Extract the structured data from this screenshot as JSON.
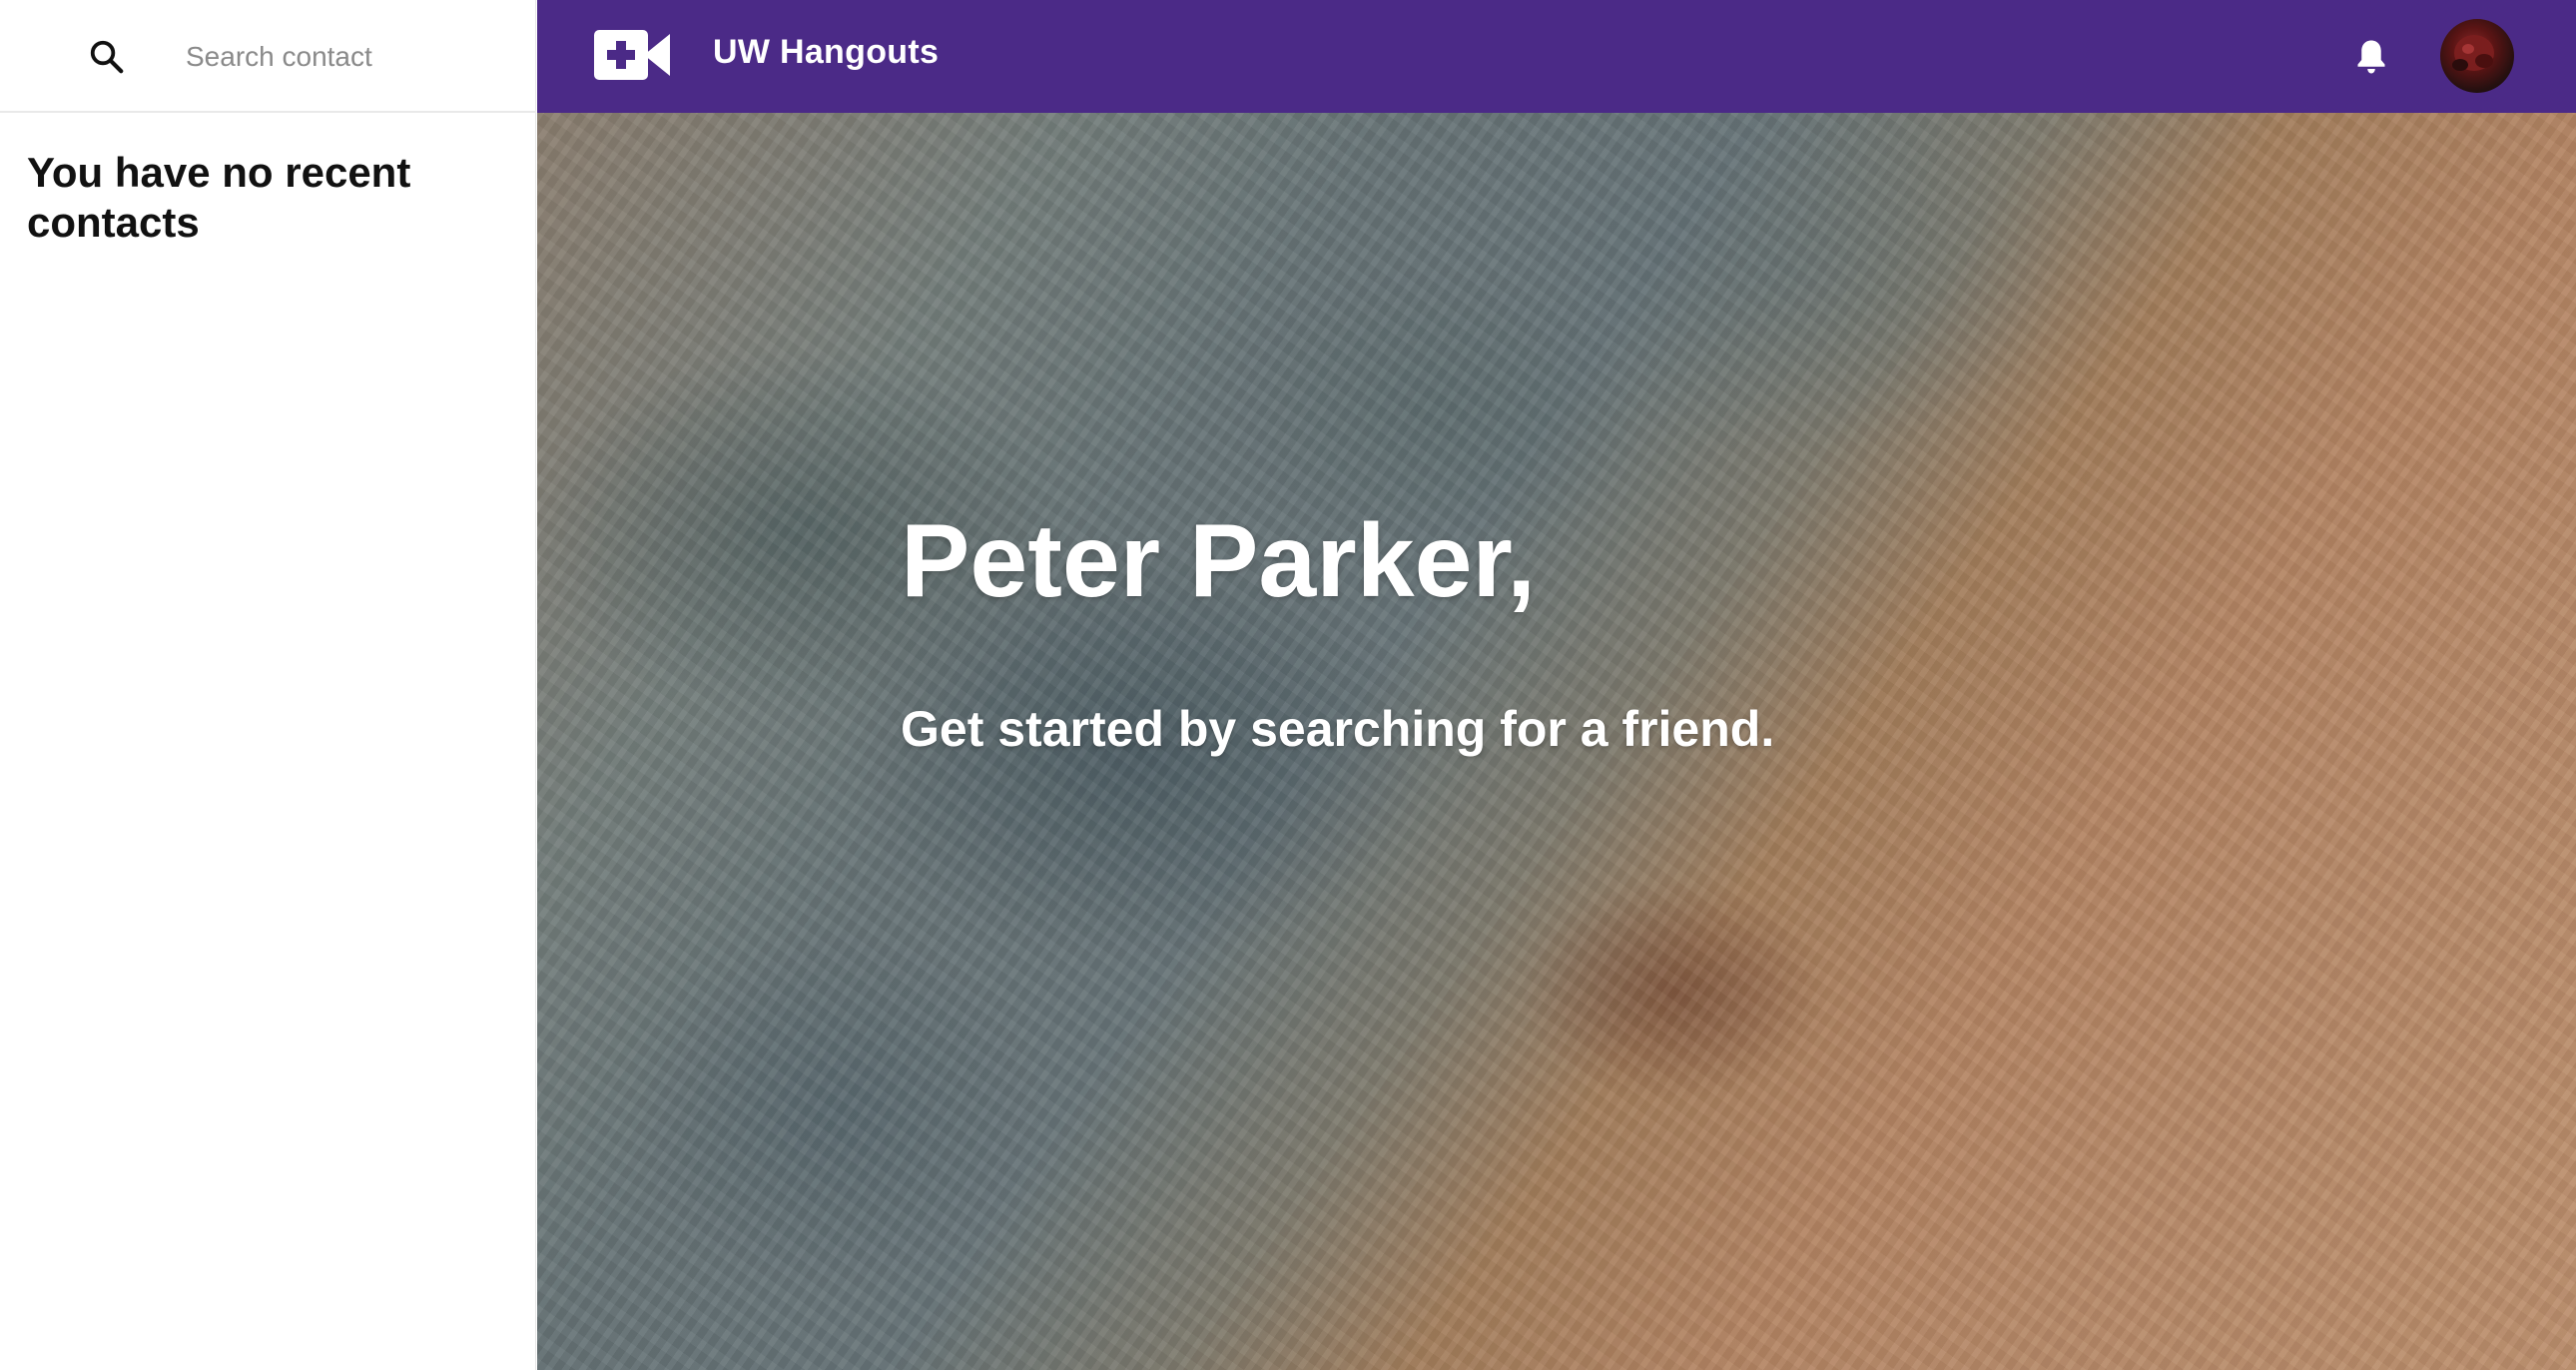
{
  "search": {
    "placeholder": "Search contact",
    "icon": "search-icon"
  },
  "sidebar": {
    "empty_message": "You have no recent contacts"
  },
  "header": {
    "logo_icon": "video-call-add-icon",
    "title": "UW Hangouts",
    "notifications_icon": "bell-icon",
    "avatar_icon": "user-avatar"
  },
  "main": {
    "greeting": "Peter Parker,",
    "subtitle": "Get started by searching for a friend."
  },
  "colors": {
    "header_bg": "#4b2a87",
    "sidebar_bg": "#ffffff",
    "text_dark": "#111111",
    "text_light": "#ffffff"
  }
}
